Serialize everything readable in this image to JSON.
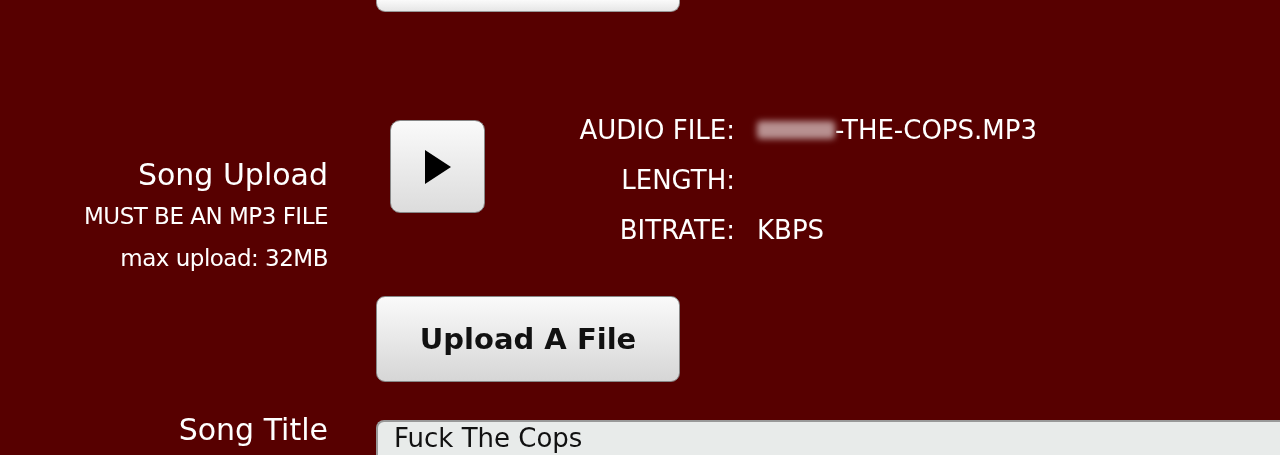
{
  "song_upload": {
    "label": "Song Upload",
    "requirement": "MUST BE AN MP3 FILE",
    "max_upload": "max upload: 32MB"
  },
  "file_info": [
    {
      "label": "AUDIO FILE:",
      "value": "-THE-COPS.MP3",
      "redacted": true
    },
    {
      "label": "LENGTH:",
      "redacted": false
    },
    {
      "label": "BITRATE:",
      "value": "KBPS",
      "redacted": false
    }
  ],
  "upload_button": "Upload A File",
  "song_title": {
    "label": "Song Title",
    "value": "Fuck The Cops"
  }
}
